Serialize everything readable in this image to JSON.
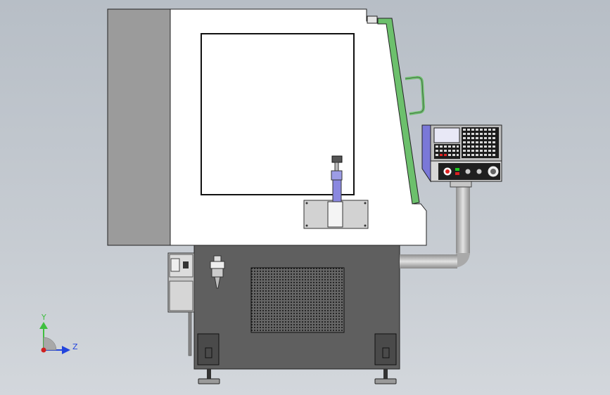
{
  "viewport": {
    "background_top": "#b7bec6",
    "background_bottom": "#d3d7dc"
  },
  "machine": {
    "enclosure_color": "#ffffff",
    "side_panel_color": "#9b9b9b",
    "base_color": "#5f5f5f",
    "door_accent_color": "#6cc06c",
    "panel_accent_color": "#7a78d8",
    "pipe_color": "#b8b8b8"
  },
  "triad": {
    "y_label": "Y",
    "z_label": "Z",
    "y_color": "#3fbf3f",
    "z_color": "#2244dd",
    "x_color": "#d02020"
  }
}
